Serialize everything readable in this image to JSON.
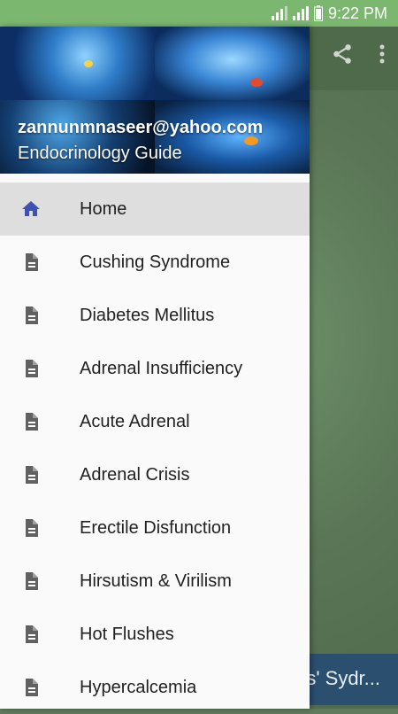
{
  "status_bar": {
    "time": "9:22 PM"
  },
  "app_bar": {
    "share_icon": "share-icon",
    "overflow_icon": "more-vert-icon"
  },
  "background": {
    "bottom_text": "ms' Sydr..."
  },
  "drawer": {
    "header": {
      "email": "zannunmnaseer@yahoo.com",
      "app_name": "Endocrinology Guide"
    },
    "items": [
      {
        "label": "Home",
        "icon": "home-icon",
        "active": true
      },
      {
        "label": "Cushing Syndrome",
        "icon": "document-icon"
      },
      {
        "label": "Diabetes Mellitus",
        "icon": "document-icon"
      },
      {
        "label": "Adrenal Insufficiency",
        "icon": "document-icon"
      },
      {
        "label": "Acute Adrenal",
        "icon": "document-icon"
      },
      {
        "label": "Adrenal Crisis",
        "icon": "document-icon"
      },
      {
        "label": "Erectile Disfunction",
        "icon": "document-icon"
      },
      {
        "label": "Hirsutism & Virilism",
        "icon": "document-icon"
      },
      {
        "label": "Hot Flushes",
        "icon": "document-icon"
      },
      {
        "label": "Hypercalcemia",
        "icon": "document-icon"
      }
    ]
  },
  "colors": {
    "status_bar": "#7bb76f",
    "app_bar": "#4f6a4a",
    "active_icon": "#3f51b5",
    "doc_icon": "#616161",
    "active_row": "#dedede"
  }
}
